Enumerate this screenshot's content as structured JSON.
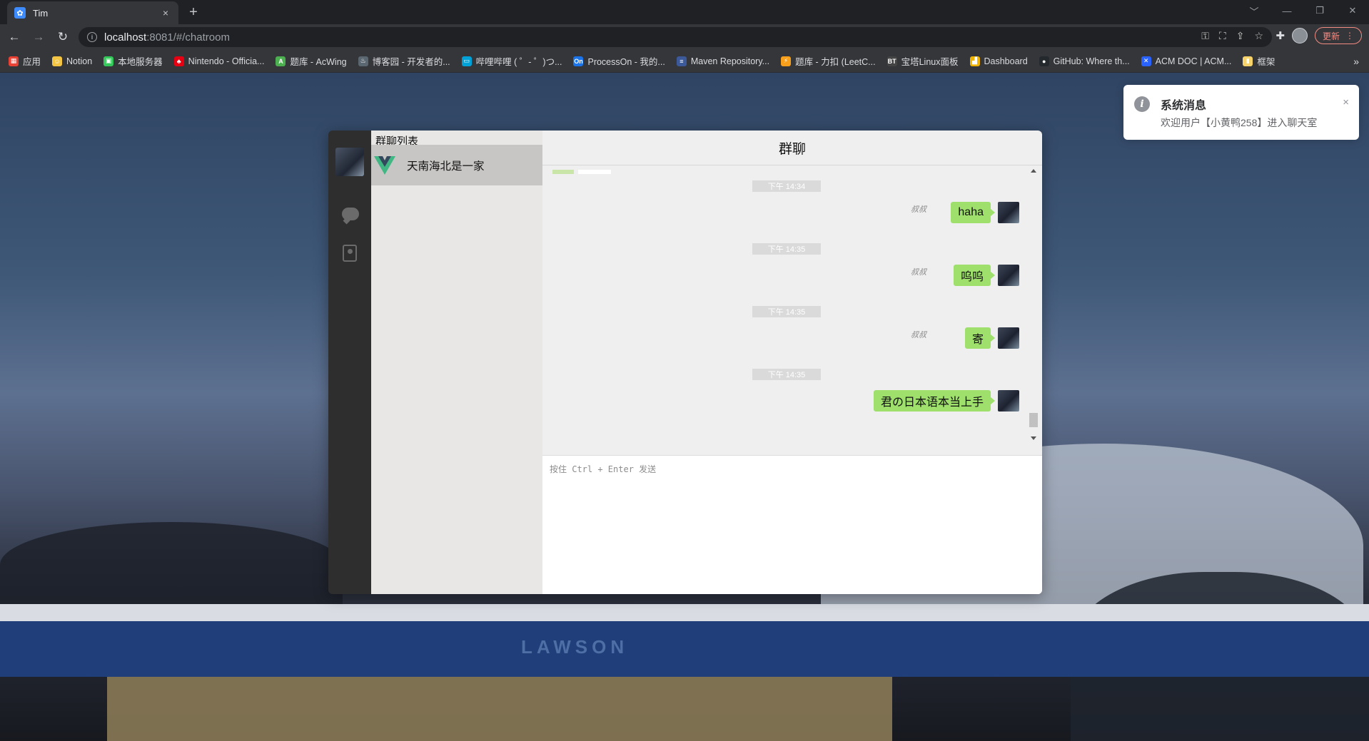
{
  "browser": {
    "tab_title": "Tim",
    "tab_close": "×",
    "new_tab": "+",
    "url_host": "localhost",
    "url_rest": ":8081/#/chatroom",
    "update_label": "更新",
    "window_controls": [
      "﹀",
      "—",
      "❐",
      "✕"
    ],
    "bookmarks": [
      {
        "label": "应用",
        "color": "#e94235",
        "glyph": "▦"
      },
      {
        "label": "Notion",
        "color": "#f4c542",
        "glyph": "☺"
      },
      {
        "label": "本地服务器",
        "color": "#34c759",
        "glyph": "▣"
      },
      {
        "label": "Nintendo - Officia...",
        "color": "#e60012",
        "glyph": "♣"
      },
      {
        "label": "题库 - AcWing",
        "color": "#4caf50",
        "glyph": "A"
      },
      {
        "label": "博客园 - 开发者的...",
        "color": "#5b6770",
        "glyph": "♨"
      },
      {
        "label": "哔哩哔哩 ( ゜- ゜)つ...",
        "color": "#00a1d6",
        "glyph": "▭"
      },
      {
        "label": "ProcessOn - 我的...",
        "color": "#1a73e8",
        "glyph": "On"
      },
      {
        "label": "Maven Repository...",
        "color": "#3c5a99",
        "glyph": "≡"
      },
      {
        "label": "题库 - 力扣 (LeetC...",
        "color": "#f89f1b",
        "glyph": "⚡"
      },
      {
        "label": "宝塔Linux面板",
        "color": "#444444",
        "glyph": "BT"
      },
      {
        "label": "Dashboard",
        "color": "#f0b400",
        "glyph": "▟"
      },
      {
        "label": "GitHub: Where th...",
        "color": "#24292e",
        "glyph": "●"
      },
      {
        "label": "ACM DOC | ACM...",
        "color": "#2962ff",
        "glyph": "✕"
      },
      {
        "label": "框架",
        "color": "#f6d36b",
        "glyph": "▮"
      }
    ],
    "bookmarks_more": "»"
  },
  "scene": {
    "store_sign": "LAWSON"
  },
  "chat": {
    "group_list_title": "群聊列表",
    "group_name": "天南海北是一家",
    "header_title": "群聊",
    "input_placeholder": "按住 Ctrl + Enter 发送",
    "messages": [
      {
        "time": "下午 14:34",
        "sender": "叔叔",
        "text": "haha"
      },
      {
        "time": "下午 14:35",
        "sender": "叔叔",
        "text": "呜呜"
      },
      {
        "time": "下午 14:35",
        "sender": "叔叔",
        "text": "寄"
      },
      {
        "time": "下午 14:35",
        "sender": "叔叔",
        "text": "君の日本语本当上手"
      }
    ]
  },
  "notification": {
    "icon": "i",
    "title": "系统消息",
    "text": "欢迎用户【小黄鸭258】进入聊天室",
    "close": "×"
  },
  "colors": {
    "bubble": "#9fe06d",
    "side_nav": "#2e2e2e",
    "group_panel": "#e8e7e6",
    "selected_group": "#c8c6c5",
    "chat_bg": "#efefef",
    "update_accent": "#f28b82"
  }
}
